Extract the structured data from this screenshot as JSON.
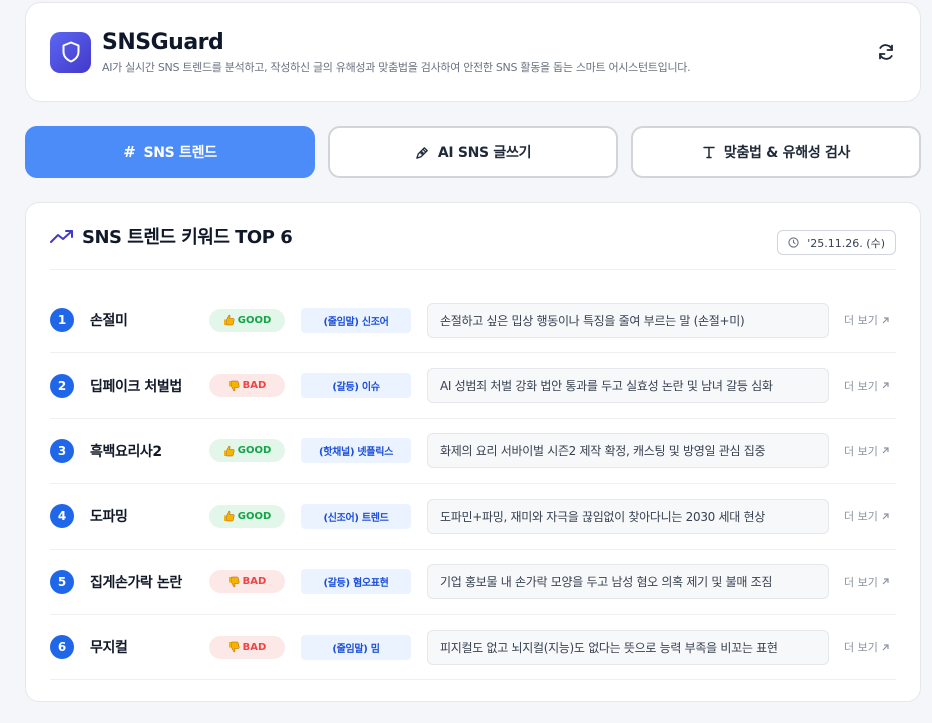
{
  "app": {
    "title": "SNSGuard",
    "subtitle": "AI가 실시간 SNS 트렌드를 분석하고, 작성하신 글의 유해성과 맞춤법을 검사하여 안전한 SNS 활동을 돕는 스마트 어시스턴트입니다.",
    "logo_icon": "shield-icon",
    "refresh_icon": "refresh-icon"
  },
  "tabs": [
    {
      "label": "SNS 트렌드",
      "icon": "hash-icon",
      "active": true
    },
    {
      "label": "AI SNS 글쓰기",
      "icon": "pen-icon",
      "active": false
    },
    {
      "label": "맞춤법 & 유해성 검사",
      "icon": "text-icon",
      "active": false
    }
  ],
  "panel": {
    "title": "SNS 트렌드 키워드 TOP 6",
    "date": "'25.11.26. (수)",
    "more_label": "더 보기",
    "trends": [
      {
        "rank": "1",
        "keyword": "손절미",
        "badge": "GOOD",
        "category": "(줄임말) 신조어",
        "desc": "손절하고 싶은 밉상 행동이나 특징을 줄여 부르는 말 (손절+미)"
      },
      {
        "rank": "2",
        "keyword": "딥페이크 처벌법",
        "badge": "BAD",
        "category": "(갈등) 이슈",
        "desc": "AI 성범죄 처벌 강화 법안 통과를 두고 실효성 논란 및 남녀 갈등 심화"
      },
      {
        "rank": "3",
        "keyword": "흑백요리사2",
        "badge": "GOOD",
        "category": "(핫채널) 넷플릭스",
        "desc": "화제의 요리 서바이벌 시즌2 제작 확정, 캐스팅 및 방영일 관심 집중"
      },
      {
        "rank": "4",
        "keyword": "도파밍",
        "badge": "GOOD",
        "category": "(신조어) 트렌드",
        "desc": "도파민+파밍, 재미와 자극을 끊임없이 찾아다니는 2030 세대 현상"
      },
      {
        "rank": "5",
        "keyword": "집게손가락 논란",
        "badge": "BAD",
        "category": "(갈등) 혐오표현",
        "desc": "기업 홍보물 내 손가락 모양을 두고 남성 혐오 의혹 제기 및 불매 조짐"
      },
      {
        "rank": "6",
        "keyword": "무지컬",
        "badge": "BAD",
        "category": "(줄임말) 밈",
        "desc": "피지컬도 없고 뇌지컬(지능)도 없다는 뜻으로 능력 부족을 비꼬는 표현"
      }
    ]
  },
  "colors": {
    "accent": "#4c8cf8",
    "rank": "#1f67e8",
    "good": "#16a34a",
    "bad": "#ef4444"
  }
}
